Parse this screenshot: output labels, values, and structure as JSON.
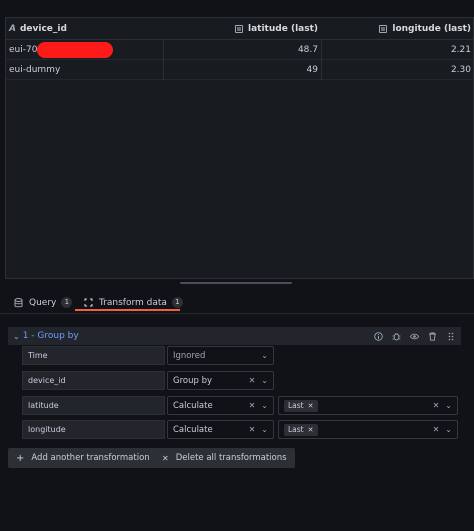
{
  "table": {
    "columns": [
      {
        "label": "device_id",
        "type_icon": "string-type-icon"
      },
      {
        "label": "latitude (last)",
        "type_icon": "number-type-icon"
      },
      {
        "label": "longitude (last)",
        "type_icon": "number-type-icon"
      }
    ],
    "rows": [
      {
        "device_id": "eui-70",
        "latitude": "48.7",
        "longitude": "2.21",
        "redacted": true
      },
      {
        "device_id": "eui-dummy",
        "latitude": "49",
        "longitude": "2.30",
        "redacted": false
      }
    ]
  },
  "tabs": [
    {
      "label": "Query",
      "count": "1",
      "icon": "database-icon"
    },
    {
      "label": "Transform data",
      "count": "1",
      "icon": "transform-icon",
      "active": true
    }
  ],
  "transformation": {
    "title": "1 - Group by",
    "fields": [
      {
        "name": "Time",
        "operation": "Ignored",
        "calculations": []
      },
      {
        "name": "device_id",
        "operation": "Group by",
        "calculations": []
      },
      {
        "name": "latitude",
        "operation": "Calculate",
        "calculations": [
          "Last"
        ]
      },
      {
        "name": "longitude",
        "operation": "Calculate",
        "calculations": [
          "Last"
        ]
      }
    ]
  },
  "buttons": {
    "add": "Add another transformation",
    "delete": "Delete all transformations"
  },
  "colors": {
    "accent": "#f55f3e",
    "link": "#6e9fff",
    "redaction": "#ff1a1a"
  }
}
